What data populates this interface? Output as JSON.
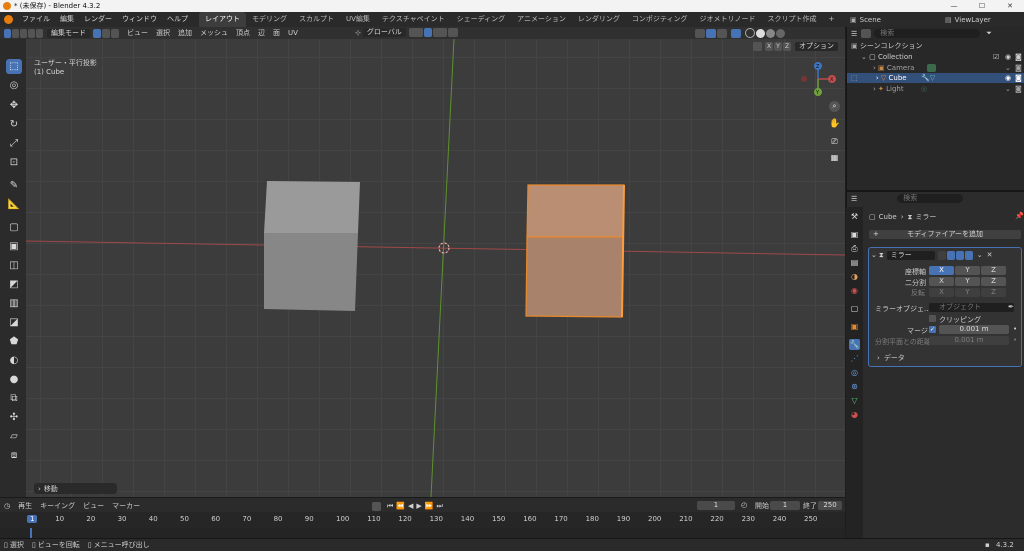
{
  "window": {
    "title": "* (未保存) - Blender 4.3.2"
  },
  "menu": {
    "items": [
      "ファイル",
      "編集",
      "レンダー",
      "ウィンドウ",
      "ヘルプ"
    ]
  },
  "workspaces": {
    "items": [
      "レイアウト",
      "モデリング",
      "スカルプト",
      "UV編集",
      "テクスチャペイント",
      "シェーディング",
      "アニメーション",
      "レンダリング",
      "コンポジティング",
      "ジオメトリノード",
      "スクリプト作成"
    ],
    "add": "+",
    "active_index": 0
  },
  "scene": {
    "name": "Scene",
    "view_layer": "ViewLayer"
  },
  "viewport_header": {
    "mode": "編集モード",
    "menus": [
      "ビュー",
      "選択",
      "追加",
      "メッシュ",
      "頂点",
      "辺",
      "面",
      "UV"
    ],
    "orientation": "グローバル",
    "xyz": [
      "X",
      "Y",
      "Z"
    ],
    "options": "オプション"
  },
  "viewport": {
    "view_name": "ユーザー・平行投影",
    "object_info": "(1) Cube",
    "last_op": "移動"
  },
  "nav_gizmo": {
    "x": "X",
    "y": "Y",
    "z": "Z"
  },
  "outliner": {
    "root": "シーンコレクション",
    "collection": "Collection",
    "items": [
      "Camera",
      "Cube",
      "Light"
    ],
    "search_placeholder": "検索"
  },
  "properties": {
    "breadcrumb": [
      "Cube",
      "ミラー"
    ],
    "add_modifier": "モディファイアーを追加",
    "modifier_name": "ミラー",
    "axis_label": "座標軸",
    "bisect_label": "二分割",
    "flip_label": "反転",
    "axes": [
      "X",
      "Y",
      "Z"
    ],
    "mirror_object_label": "ミラーオブジェ...",
    "mirror_object_placeholder": "オブジェクト",
    "clipping": "クリッピング",
    "merge_label": "マージ",
    "merge_value": "0.001 m",
    "bisect_distance_label": "分割平面との距離",
    "bisect_distance_value": "0.001 m",
    "data_panel": "データ"
  },
  "timeline": {
    "menus": [
      "再生",
      "キーイング",
      "ビュー",
      "マーカー"
    ],
    "current_frame": "1",
    "start_label": "開始",
    "start": "1",
    "end_label": "終了",
    "end": "250",
    "ticks": [
      "1",
      "10",
      "20",
      "30",
      "40",
      "50",
      "60",
      "70",
      "80",
      "90",
      "100",
      "110",
      "120",
      "130",
      "140",
      "150",
      "160",
      "170",
      "180",
      "190",
      "200",
      "210",
      "220",
      "230",
      "240",
      "250"
    ]
  },
  "status": {
    "items": [
      "選択",
      "ビューを回転",
      "メニュー呼び出し"
    ],
    "version": "4.3.2"
  },
  "colors": {
    "accent": "#4772b3",
    "selection": "#e8892b",
    "x_axis": "#b84a4a",
    "y_axis": "#6fa23c",
    "z_axis": "#3d75c5"
  }
}
